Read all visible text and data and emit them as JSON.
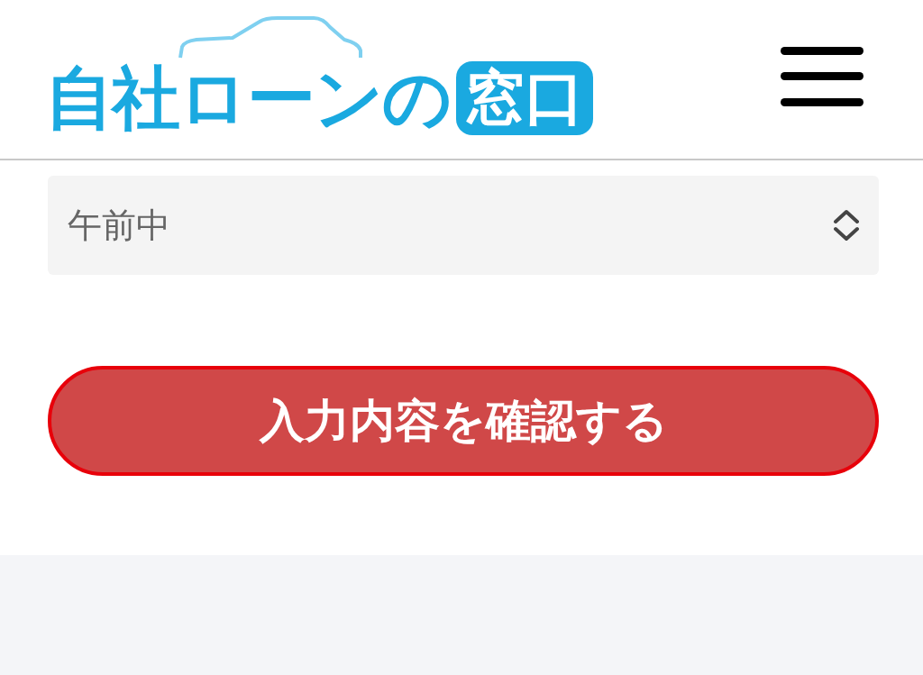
{
  "header": {
    "logo_text": "自社ローンの",
    "logo_badge": "窓口"
  },
  "form": {
    "time_select": {
      "value": "午前中"
    },
    "submit_button": {
      "label": "入力内容を確認する"
    }
  }
}
